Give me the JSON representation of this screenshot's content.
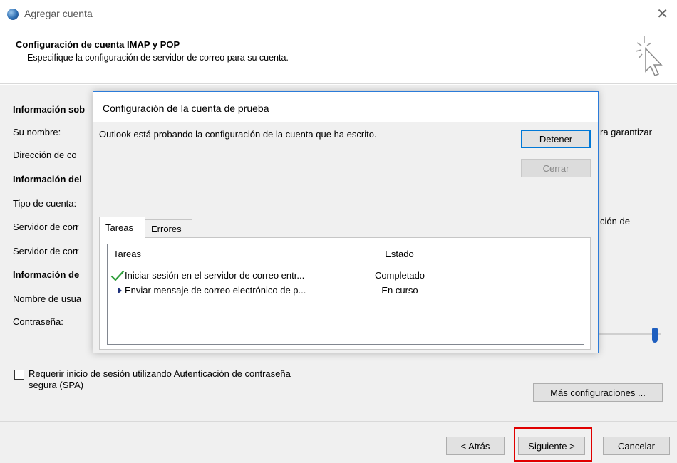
{
  "window": {
    "title": "Agregar cuenta"
  },
  "header": {
    "title": "Configuración de cuenta IMAP y POP",
    "subtitle": "Especifique la configuración de servidor de correo para su cuenta."
  },
  "background_form": {
    "section_user_info": "Información sob",
    "label_your_name": "Su nombre:",
    "label_email": "Dirección de co",
    "section_server_info": "Información del",
    "label_account_type": "Tipo de cuenta:",
    "label_incoming_server": "Servidor de corr",
    "label_outgoing_server": "Servidor de corr",
    "section_logon_info": "Información de",
    "label_username": "Nombre de usua",
    "label_password": "Contraseña:",
    "right_text_1": "ra garantizar",
    "right_text_2": "ción de",
    "spa_label": "Requerir inicio de sesión utilizando Autenticación de contraseña segura (SPA)",
    "more_settings_button": "Más configuraciones ..."
  },
  "test_dialog": {
    "title": "Configuración de la cuenta de prueba",
    "message": "Outlook está probando la configuración de la cuenta que ha escrito.",
    "stop_button": "Detener",
    "close_button": "Cerrar",
    "tabs": [
      {
        "label": "Tareas",
        "active": true
      },
      {
        "label": "Errores",
        "active": false
      }
    ],
    "columns": {
      "task": "Tareas",
      "status": "Estado"
    },
    "rows": [
      {
        "icon": "checkmark-icon",
        "task": "Iniciar sesión en el servidor de correo entr...",
        "status": "Completado"
      },
      {
        "icon": "arrow-right-icon",
        "task": "Enviar mensaje de correo electrónico de p...",
        "status": "En curso"
      }
    ]
  },
  "footer": {
    "back_button": "< Atrás",
    "next_button": "Siguiente >",
    "cancel_button": "Cancelar"
  },
  "colors": {
    "accent_blue": "#0078d7",
    "highlight_red": "#e00000",
    "check_green": "#2e9e3a",
    "arrow_navy": "#1c2f7a"
  }
}
